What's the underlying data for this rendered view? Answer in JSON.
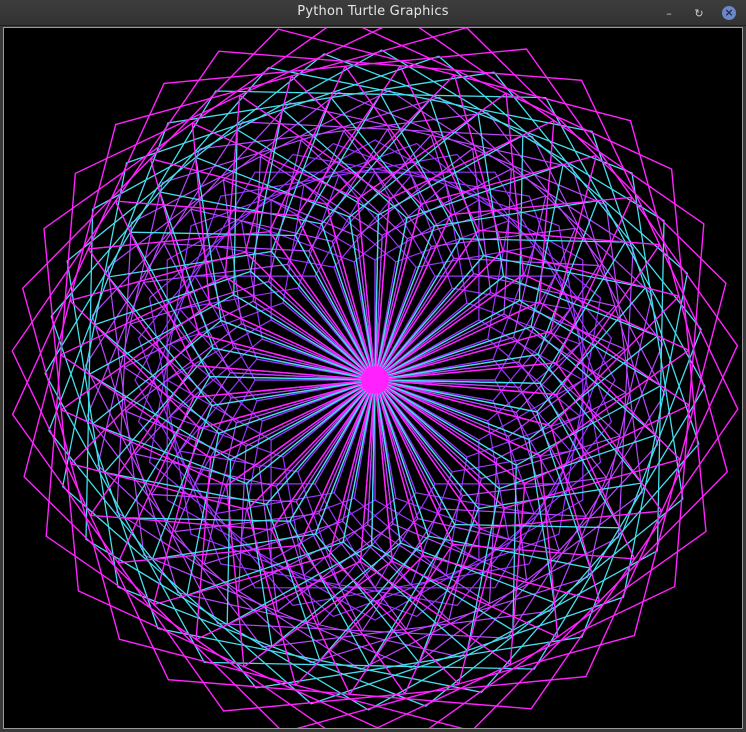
{
  "window": {
    "title": "Python Turtle Graphics",
    "buttons": {
      "minimize_glyph": "–",
      "maximize_glyph": "↻",
      "close_glyph": "×"
    }
  },
  "canvas": {
    "background": "#000000",
    "colors": {
      "magenta": "#ff22ff",
      "cyan": "#44ddee",
      "violet": "#9933ff",
      "purple": "#bb44ff"
    }
  }
}
